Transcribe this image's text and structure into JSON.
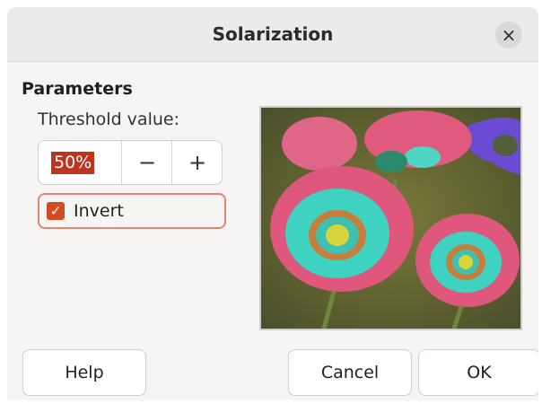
{
  "dialog": {
    "title": "Solarization",
    "close_glyph": "×"
  },
  "parameters": {
    "section_title": "Parameters",
    "threshold_label": "Threshold value:",
    "threshold_value": "50%",
    "decrement_glyph": "−",
    "increment_glyph": "+",
    "invert_label": "Invert",
    "invert_checked": true,
    "check_glyph": "✓"
  },
  "preview": {
    "description_icon": "solarized-poppies-image"
  },
  "buttons": {
    "help": "Help",
    "cancel": "Cancel",
    "ok": "OK"
  },
  "colors": {
    "accent": "#d34a23",
    "selection": "#c0341d",
    "focus_border": "#e0876f"
  }
}
